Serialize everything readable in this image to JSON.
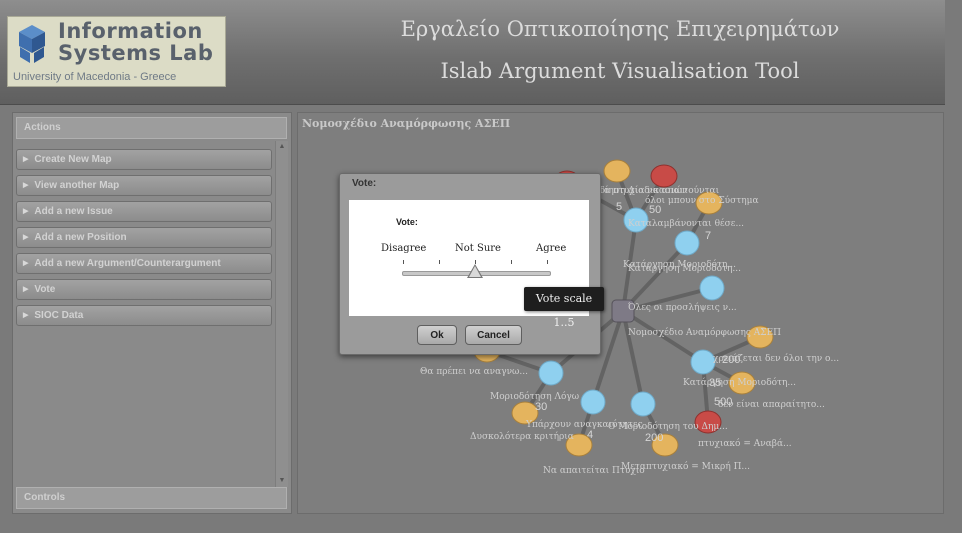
{
  "logo": {
    "line1": "Information",
    "line2": "Systems Lab",
    "line3": "University of Macedonia - Greece"
  },
  "header": {
    "title_greek": "Εργαλείο Οπτικοποίησης Επιχειρημάτων",
    "title_english": "Islab Argument Visualisation Tool"
  },
  "sidebar": {
    "actions_label": "Actions",
    "items": [
      {
        "label": "Create New Map"
      },
      {
        "label": "View another Map"
      },
      {
        "label": "Add a new Issue"
      },
      {
        "label": "Add a new Position"
      },
      {
        "label": "Add a new Argument/Counterargument"
      },
      {
        "label": "Vote"
      },
      {
        "label": "SIOC Data"
      }
    ],
    "controls_label": "Controls"
  },
  "map": {
    "title": "Νομοσχέδιο Αναμόρφωσης ΑΣΕΠ",
    "node_labels": [
      "Απλοποίηση Διαδικασιών",
      "όλοι μπουν στο Σύστημα",
      "Καταλαμβάνονται θέσε...",
      "Κατάργηση Μοριοδότη...",
      "Κατάργηση Μοριοδότη...",
      "Όλες οι προσλήψεις ν...",
      "Νομοσχέδιο Αναμόρφωσης ΑΣΕΠ",
      "Θα πρέπει να αναγνω...",
      "Μοριοδότηση Λόγω",
      "Υπάρχουν αναγκαιότητες",
      "Δυσκολότερα κριτήρια",
      "Να απαιτείται Πτυχίο",
      "Κατάργηση Μοριοδότη...",
      "Τα πτυχία να απαιτούνται",
      "δεν είναι απαραίτητο...",
      "Ο Μοριοδότηση του Δημ...",
      "πτυχιακό = Αναβά...",
      "Μεταπτυχιακό = Μικρή Π...",
      "χρειάζεται δεν όλοι την ο..."
    ],
    "vote_counts": [
      "5",
      "50",
      "7",
      "200",
      "35",
      "500",
      "30",
      "4",
      "200"
    ],
    "colors": {
      "position_node": "#8fd0ef",
      "pro_bubble": "#e4b45e",
      "con_bubble": "#c84b47",
      "edge": "#5a5a5a"
    }
  },
  "dialog": {
    "title": "Vote:",
    "vote_label": "Vote:",
    "scale_labels": {
      "left": "Disagree",
      "middle": "Not Sure",
      "right": "Agree"
    },
    "slider_value": 3,
    "slider_min": 1,
    "slider_max": 5,
    "ok_label": "Ok",
    "cancel_label": "Cancel"
  },
  "tooltip": {
    "text": "Vote scale 1..5"
  }
}
